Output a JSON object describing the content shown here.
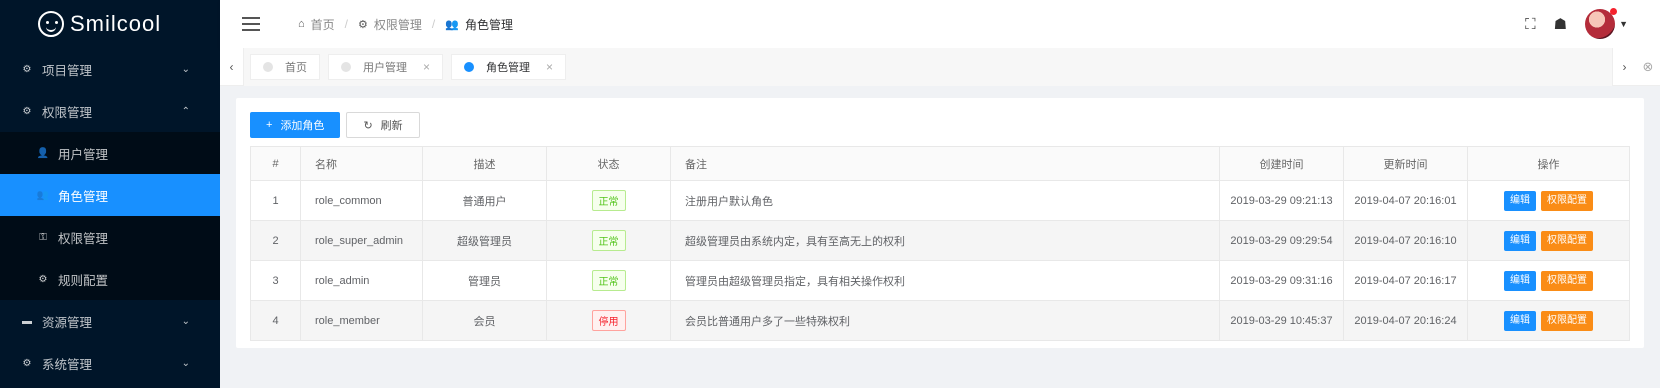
{
  "brand": {
    "name": "Smilcool"
  },
  "sidebar": {
    "items": [
      {
        "label": "项目管理",
        "icon": "gear-icon",
        "arrow": "⌄"
      },
      {
        "label": "权限管理",
        "icon": "gear-icon",
        "arrow": "⌃"
      },
      {
        "label": "用户管理",
        "icon": "user-icon"
      },
      {
        "label": "角色管理",
        "icon": "users-icon"
      },
      {
        "label": "权限管理",
        "icon": "key-icon"
      },
      {
        "label": "规则配置",
        "icon": "gear-icon"
      },
      {
        "label": "资源管理",
        "icon": "folder-icon",
        "arrow": "⌄"
      },
      {
        "label": "系统管理",
        "icon": "gear-icon",
        "arrow": "⌄"
      }
    ]
  },
  "header": {
    "breadcrumb": [
      "首页",
      "权限管理",
      "角色管理"
    ]
  },
  "tabs": [
    {
      "label": "首页"
    },
    {
      "label": "用户管理"
    },
    {
      "label": "角色管理"
    }
  ],
  "toolbar": {
    "add_label": "添加角色",
    "refresh_label": "刷新"
  },
  "table": {
    "columns": [
      "#",
      "名称",
      "描述",
      "状态",
      "备注",
      "创建时间",
      "更新时间",
      "操作"
    ],
    "rows": [
      {
        "id": "1",
        "name": "role_common",
        "desc": "普通用户",
        "status": "正常",
        "remark": "注册用户默认角色",
        "created": "2019-03-29 09:21:13",
        "updated": "2019-04-07 20:16:01"
      },
      {
        "id": "2",
        "name": "role_super_admin",
        "desc": "超级管理员",
        "status": "正常",
        "remark": "超级管理员由系统内定，具有至高无上的权利",
        "created": "2019-03-29 09:29:54",
        "updated": "2019-04-07 20:16:10"
      },
      {
        "id": "3",
        "name": "role_admin",
        "desc": "管理员",
        "status": "正常",
        "remark": "管理员由超级管理员指定，具有相关操作权利",
        "created": "2019-03-29 09:31:16",
        "updated": "2019-04-07 20:16:17"
      },
      {
        "id": "4",
        "name": "role_member",
        "desc": "会员",
        "status": "停用",
        "remark": "会员比普通用户多了一些特殊权利",
        "created": "2019-03-29 10:45:37",
        "updated": "2019-04-07 20:16:24"
      }
    ],
    "edit_label": "编辑",
    "perm_label": "权限配置"
  }
}
